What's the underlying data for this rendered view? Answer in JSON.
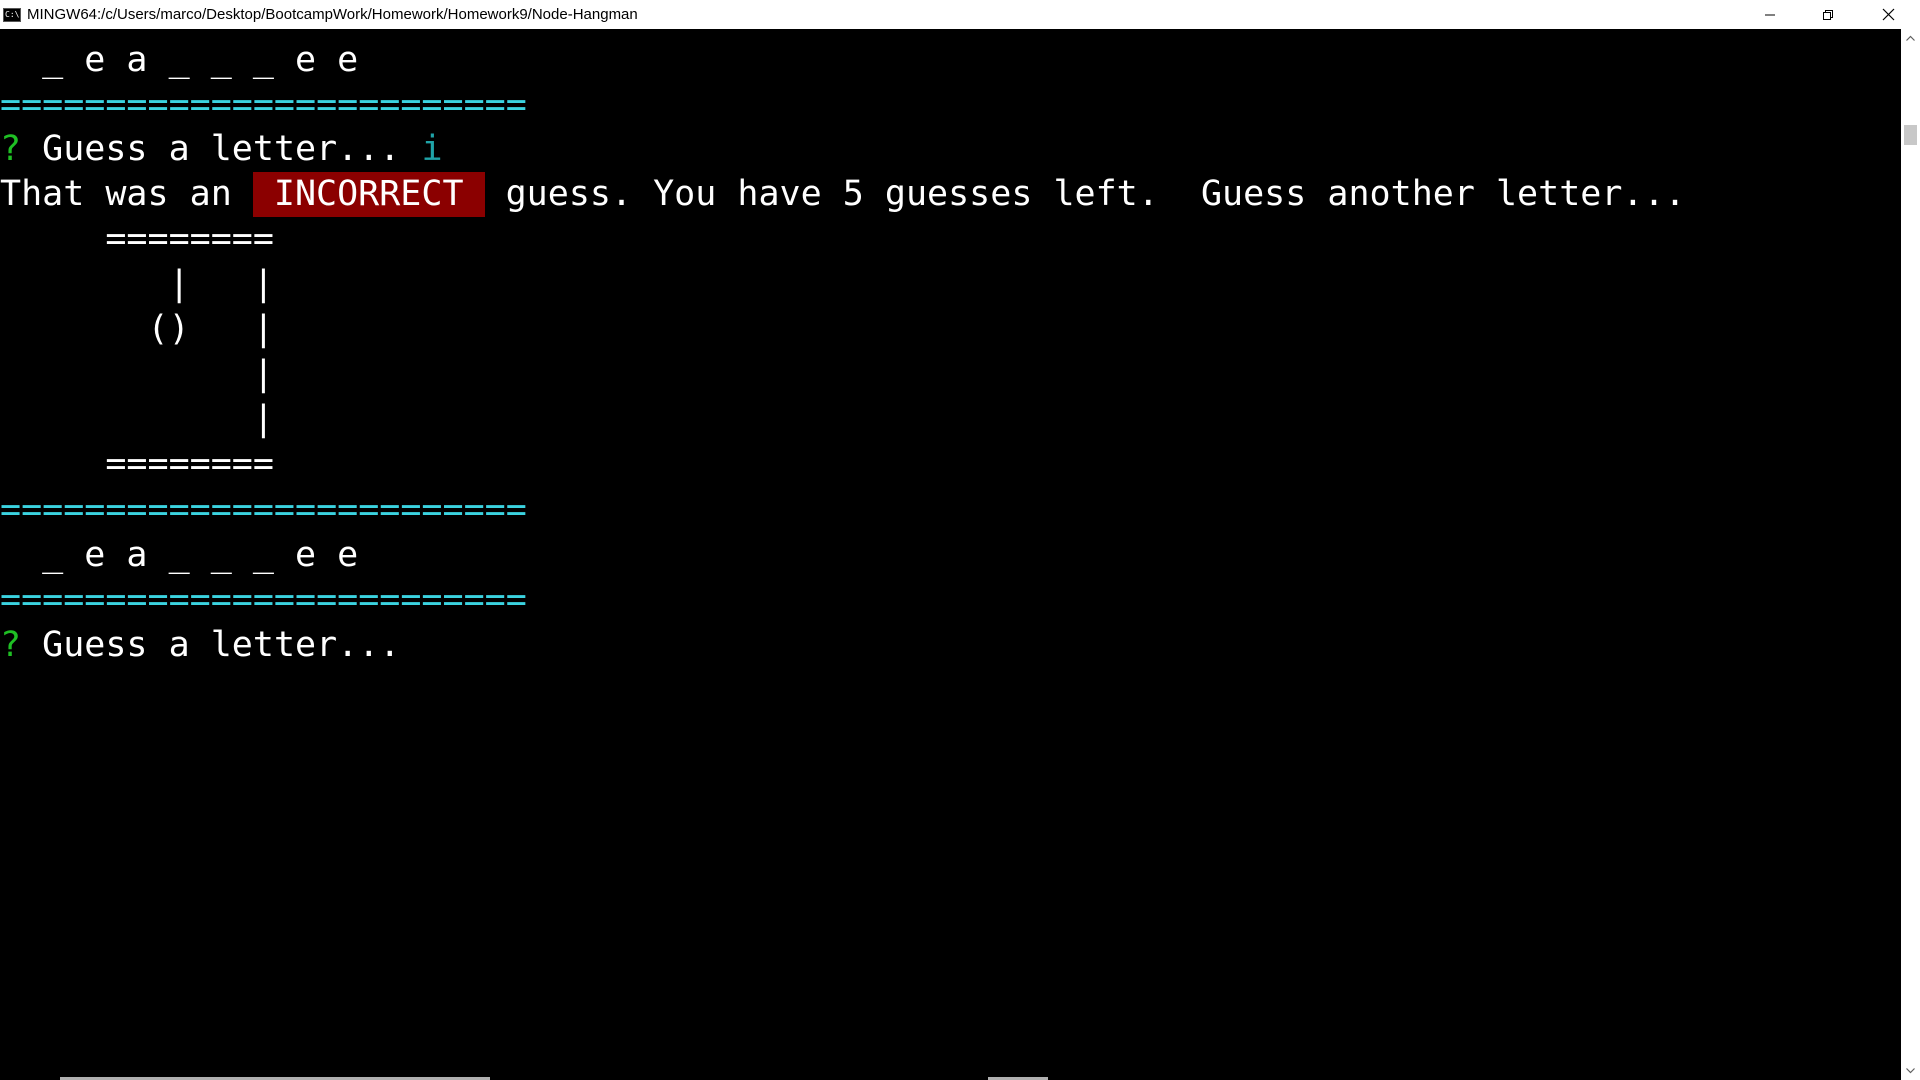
{
  "window": {
    "title": "MINGW64:/c/Users/marco/Desktop/BootcampWork/Homework/Homework9/Node-Hangman",
    "icon_label": "C:\\"
  },
  "terminal": {
    "word_top": "  _ e a _ _ _ e e",
    "divider": "=========================",
    "prompt_symbol": "?",
    "prompt_text": " Guess a letter... ",
    "answer": "i",
    "incorrect_prefix": "That was an ",
    "incorrect_badge": "INCORRECT",
    "incorrect_suffix": " guess. You have 5 guesses left.  Guess another letter...",
    "gallows": [
      "     ========",
      "        |   |",
      "       ()   |",
      "            |",
      "            |",
      "     ========"
    ],
    "word_bottom": "  _ e a _ _ _ e e",
    "prompt_text_2": " Guess a letter..."
  },
  "colors": {
    "background": "#000000",
    "divider": "#3bd3e0",
    "prompt_symbol": "#1fbf24",
    "answer": "#1fa3a8",
    "incorrect_bg": "#8b0000"
  },
  "icons": {
    "minimize": "minimize-icon",
    "maximize": "restore-icon",
    "close": "close-icon",
    "scroll_up": "chevron-up-icon",
    "scroll_down": "chevron-down-icon"
  }
}
